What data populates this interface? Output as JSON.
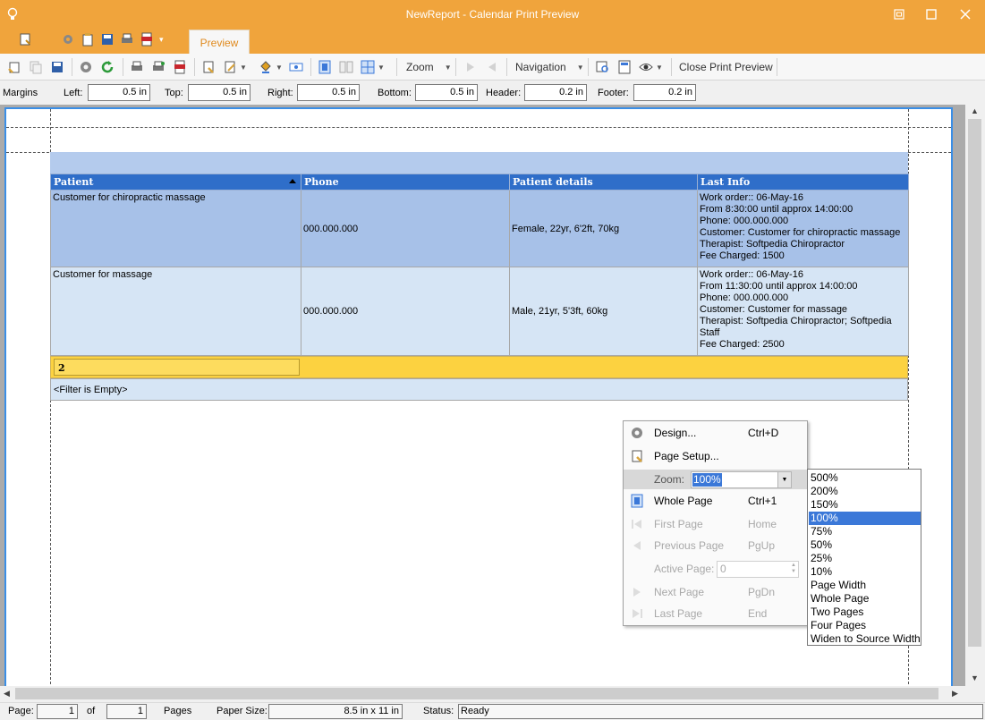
{
  "window": {
    "title": "NewReport - Calendar Print Preview",
    "tab_label": "Preview",
    "colors": {
      "titlebar": "#f0a43c",
      "accent": "#3b78d8",
      "header_row": "#2f6ec9",
      "group_band": "#fcd240"
    }
  },
  "toolbar": {
    "zoom_label": "Zoom",
    "navigation_label": "Navigation",
    "close_label": "Close Print Preview"
  },
  "margins": {
    "title": "Margins",
    "left_label": "Left:",
    "left_value": "0.5 in",
    "top_label": "Top:",
    "top_value": "0.5 in",
    "right_label": "Right:",
    "right_value": "0.5 in",
    "bottom_label": "Bottom:",
    "bottom_value": "0.5 in",
    "header_label": "Header:",
    "header_value": "0.2 in",
    "footer_label": "Footer:",
    "footer_value": "0.2 in"
  },
  "report": {
    "columns": [
      "Patient",
      "Phone",
      "Patient details",
      "Last Info"
    ],
    "rows": [
      {
        "patient": "Customer for chiropractic massage",
        "phone": "000.000.000",
        "details": "Female, 22yr, 6'2ft, 70kg",
        "info": [
          "Work order:: 06-May-16",
          "From 8:30:00 until approx 14:00:00",
          "Phone: 000.000.000",
          "Customer: Customer for chiropractic massage",
          "Therapist: Softpedia Chiropractor",
          "Fee Charged: 1500"
        ]
      },
      {
        "patient": "Customer for massage",
        "phone": "000.000.000",
        "details": "Male, 21yr, 5'3ft, 60kg",
        "info": [
          "Work order:: 06-May-16",
          "From 11:30:00 until approx 14:00:00",
          "Phone: 000.000.000",
          "Customer: Customer for massage",
          "Therapist: Softpedia Chiropractor; Softpedia",
          "Staff",
          "Fee Charged: 2500"
        ]
      }
    ],
    "group_count": "2",
    "filter_text": "<Filter is Empty>"
  },
  "context_menu": {
    "design_label": "Design...",
    "design_shortcut": "Ctrl+D",
    "page_setup_label": "Page Setup...",
    "zoom_label": "Zoom:",
    "zoom_value": "100%",
    "whole_page_label": "Whole Page",
    "whole_page_shortcut": "Ctrl+1",
    "first_page_label": "First Page",
    "first_page_shortcut": "Home",
    "previous_page_label": "Previous Page",
    "previous_page_shortcut": "PgUp",
    "active_page_label": "Active Page:",
    "active_page_value": "0",
    "next_page_label": "Next Page",
    "next_page_shortcut": "PgDn",
    "last_page_label": "Last Page",
    "last_page_shortcut": "End"
  },
  "zoom_dropdown": {
    "options": [
      "500%",
      "200%",
      "150%",
      "100%",
      "75%",
      "50%",
      "25%",
      "10%",
      "Page Width",
      "Whole Page",
      "Two Pages",
      "Four Pages",
      "Widen to Source Width"
    ],
    "selected": "100%"
  },
  "status": {
    "page_label": "Page:",
    "page_value": "1",
    "of_label": "of",
    "total_value": "1",
    "pages_label": "Pages",
    "paper_size_label": "Paper Size:",
    "paper_size_value": "8.5 in x 11 in",
    "status_label": "Status:",
    "status_value": "Ready"
  }
}
